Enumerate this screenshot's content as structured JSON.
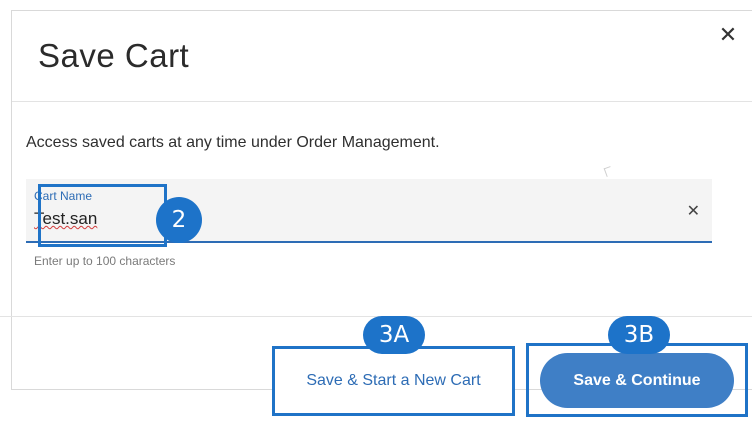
{
  "modal": {
    "title": "Save Cart",
    "close_icon": "close-icon",
    "description": "Access saved carts at any time under Order Management."
  },
  "field": {
    "label": "Cart Name",
    "value": "Test.san",
    "helper": "Enter up to 100 characters",
    "clear_icon": "clear-icon"
  },
  "buttons": {
    "secondary_label": "Save & Start a New Cart",
    "primary_label": "Save & Continue"
  },
  "annotations": {
    "field_callout": "2",
    "secondary_callout": "3A",
    "primary_callout": "3B"
  },
  "colors": {
    "accent": "#2d6cb5",
    "primary_button": "#3f7fc6",
    "annotation": "#1d73c9"
  }
}
